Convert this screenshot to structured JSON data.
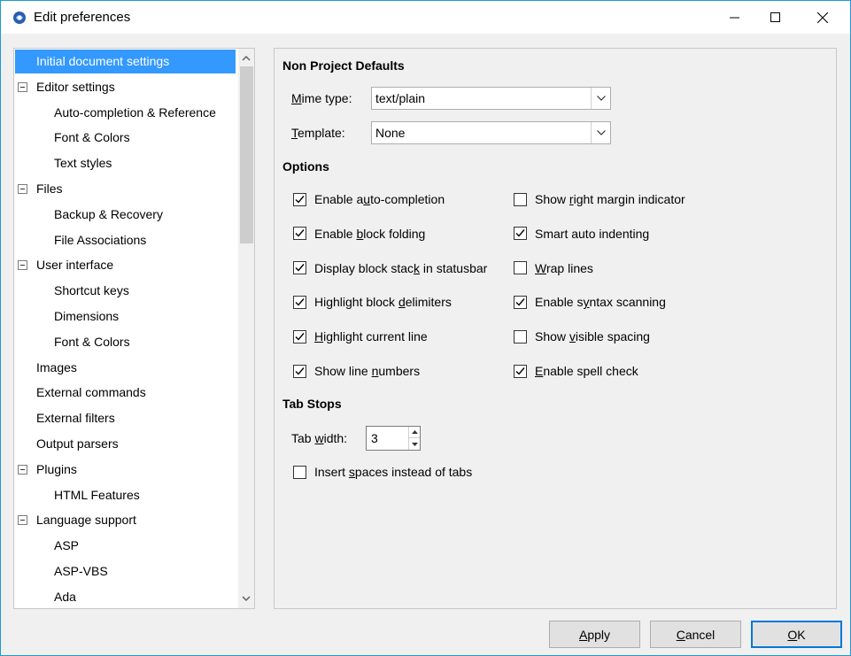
{
  "window": {
    "title": "Edit preferences",
    "accent_color": "#1a9bd7"
  },
  "tree": {
    "items": [
      {
        "label": "Initial document settings",
        "level": 0,
        "expander": false,
        "selected": true
      },
      {
        "label": "Editor settings",
        "level": 0,
        "expander": true,
        "selected": false
      },
      {
        "label": "Auto-completion & Reference",
        "level": 1,
        "expander": false,
        "selected": false
      },
      {
        "label": "Font & Colors",
        "level": 1,
        "expander": false,
        "selected": false
      },
      {
        "label": "Text styles",
        "level": 1,
        "expander": false,
        "selected": false
      },
      {
        "label": "Files",
        "level": 0,
        "expander": true,
        "selected": false
      },
      {
        "label": "Backup & Recovery",
        "level": 1,
        "expander": false,
        "selected": false
      },
      {
        "label": "File Associations",
        "level": 1,
        "expander": false,
        "selected": false
      },
      {
        "label": "User interface",
        "level": 0,
        "expander": true,
        "selected": false
      },
      {
        "label": "Shortcut keys",
        "level": 1,
        "expander": false,
        "selected": false
      },
      {
        "label": "Dimensions",
        "level": 1,
        "expander": false,
        "selected": false
      },
      {
        "label": "Font & Colors",
        "level": 1,
        "expander": false,
        "selected": false
      },
      {
        "label": "Images",
        "level": 0,
        "expander": false,
        "selected": false
      },
      {
        "label": "External commands",
        "level": 0,
        "expander": false,
        "selected": false
      },
      {
        "label": "External filters",
        "level": 0,
        "expander": false,
        "selected": false
      },
      {
        "label": "Output parsers",
        "level": 0,
        "expander": false,
        "selected": false
      },
      {
        "label": "Plugins",
        "level": 0,
        "expander": true,
        "selected": false
      },
      {
        "label": "HTML Features",
        "level": 1,
        "expander": false,
        "selected": false
      },
      {
        "label": "Language support",
        "level": 0,
        "expander": true,
        "selected": false
      },
      {
        "label": "ASP",
        "level": 1,
        "expander": false,
        "selected": false
      },
      {
        "label": "ASP-VBS",
        "level": 1,
        "expander": false,
        "selected": false
      },
      {
        "label": "Ada",
        "level": 1,
        "expander": false,
        "selected": false
      }
    ],
    "selected_color": "#3399ff"
  },
  "settings": {
    "non_project_defaults": {
      "title": "Non Project Defaults",
      "mime_type_label_pre": "",
      "mime_type_label_u": "M",
      "mime_type_label_post": "ime type:",
      "mime_type_value": "text/plain",
      "template_label_u": "T",
      "template_label_post": "emplate:",
      "template_value": "None"
    },
    "options": {
      "title": "Options",
      "left": [
        {
          "pre": "Enable a",
          "u": "u",
          "post": "to-completion",
          "checked": true
        },
        {
          "pre": "Enable ",
          "u": "b",
          "post": "lock folding",
          "checked": true
        },
        {
          "pre": "Display block stac",
          "u": "k",
          "post": " in statusbar",
          "checked": true
        },
        {
          "pre": "Highlight block ",
          "u": "d",
          "post": "elimiters",
          "checked": true
        },
        {
          "pre": "",
          "u": "H",
          "post": "ighlight current line",
          "checked": true
        },
        {
          "pre": "Show line ",
          "u": "n",
          "post": "umbers",
          "checked": true
        }
      ],
      "right": [
        {
          "pre": "Show ",
          "u": "r",
          "post": "ight margin indicator",
          "checked": false
        },
        {
          "pre": "Smart auto indenting",
          "u": "",
          "post": "",
          "checked": true
        },
        {
          "pre": "",
          "u": "W",
          "post": "rap lines",
          "checked": false
        },
        {
          "pre": "Enable s",
          "u": "y",
          "post": "ntax scanning",
          "checked": true
        },
        {
          "pre": "Show ",
          "u": "v",
          "post": "isible spacing",
          "checked": false
        },
        {
          "pre": "",
          "u": "E",
          "post": "nable spell check",
          "checked": true
        }
      ]
    },
    "tab_stops": {
      "title": "Tab Stops",
      "tab_width_pre": "Tab ",
      "tab_width_u": "w",
      "tab_width_post": "idth:",
      "tab_width_value": "3",
      "insert_spaces_pre": "Insert ",
      "insert_spaces_u": "s",
      "insert_spaces_post": "paces instead of tabs",
      "insert_spaces_checked": false
    }
  },
  "buttons": {
    "apply_u": "A",
    "apply_post": "pply",
    "cancel_u": "C",
    "cancel_post": "ancel",
    "ok_u": "O",
    "ok_post": "K"
  }
}
